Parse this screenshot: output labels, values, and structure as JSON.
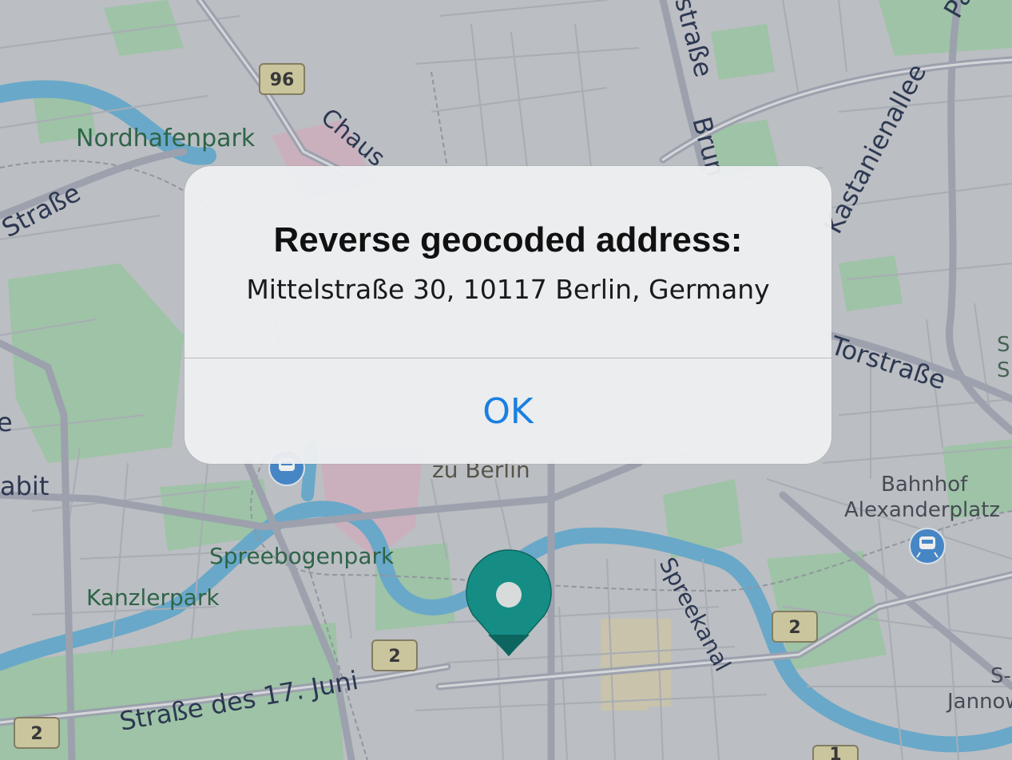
{
  "map": {
    "labels": {
      "nordhafenpark": "Nordhafenpark",
      "strasse_left": "Straße",
      "chaus": "Chaus",
      "strasse_top": "straße",
      "brun": "Brun",
      "kastanienallee": "Kastanienallee",
      "pa": "Pa",
      "torstrasse": "Torstraße",
      "abit": "abit",
      "e_left": "e",
      "zu_berlin": "zu Berlin",
      "bahnhof": "Bahnhof",
      "alexanderplatz": "Alexanderplatz",
      "spreebogenpark": "Spreebogenpark",
      "kanzlerpark": "Kanzlerpark",
      "spreekanal": "Spreekanal",
      "strasse_17_juni": "Straße des 17. Juni",
      "s_dash": "S-",
      "jannow": "Jannow",
      "s_right1": "S",
      "s_right2": "S"
    },
    "shields": {
      "b96": "96",
      "b2_center": "2",
      "b2_right": "2",
      "b2_bottomleft": "2",
      "b1_bottom": "1"
    },
    "colors": {
      "land": "#c8cbcf",
      "park": "#a9d1b0",
      "water": "#6fb3d6",
      "pin": "#14968c",
      "pin_dark": "#0b6b63",
      "road_major": "#a6acb8"
    }
  },
  "dialog": {
    "title": "Reverse geocoded address:",
    "message": "Mittelstraße 30, 10117 Berlin, Germany",
    "ok_label": "OK"
  }
}
